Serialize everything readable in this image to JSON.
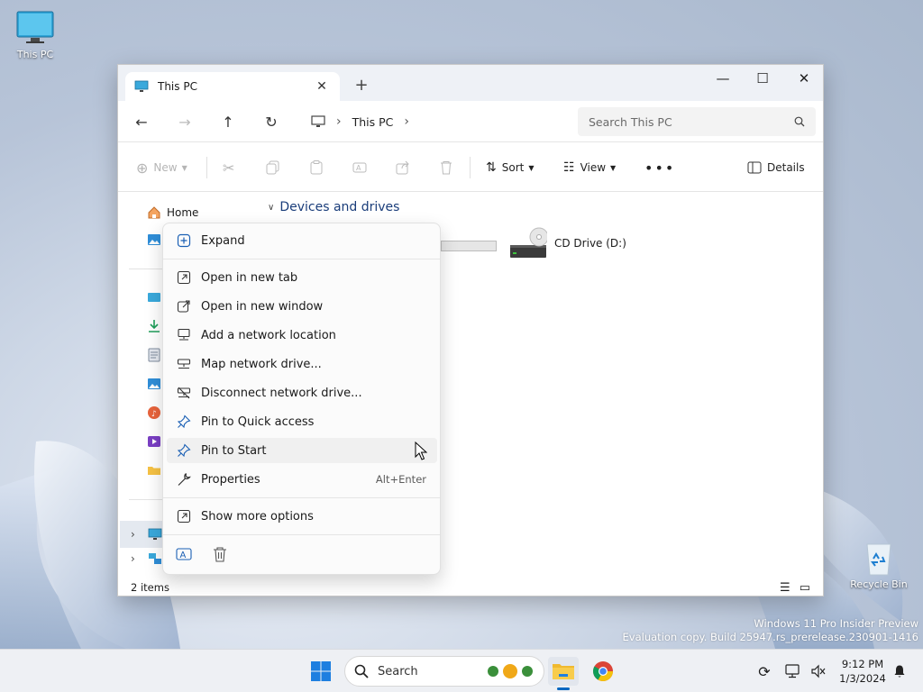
{
  "desktop": {
    "icons": [
      {
        "label": "This PC"
      },
      {
        "label": "Recycle Bin"
      }
    ]
  },
  "window": {
    "tab_title": "This PC",
    "address": {
      "segments": [
        "This PC"
      ]
    },
    "search_placeholder": "Search This PC",
    "commands": {
      "new": "New",
      "sort": "Sort",
      "view": "View",
      "details": "Details"
    },
    "sidebar": {
      "home": "Home"
    },
    "group_title": "Devices and drives",
    "drives": [
      {
        "label": "CD Drive (D:)"
      }
    ],
    "status": "2 items"
  },
  "context_menu": {
    "items": [
      {
        "label": "Expand",
        "icon": "expand-icon"
      },
      {
        "label": "Open in new tab",
        "icon": "new-tab-icon"
      },
      {
        "label": "Open in new window",
        "icon": "new-window-icon"
      },
      {
        "label": "Add a network location",
        "icon": "network-location-icon"
      },
      {
        "label": "Map network drive...",
        "icon": "map-drive-icon"
      },
      {
        "label": "Disconnect network drive...",
        "icon": "disconnect-drive-icon"
      },
      {
        "label": "Pin to Quick access",
        "icon": "pin-icon"
      },
      {
        "label": "Pin to Start",
        "icon": "pin-start-icon"
      },
      {
        "label": "Properties",
        "icon": "wrench-icon",
        "shortcut": "Alt+Enter"
      },
      {
        "label": "Show more options",
        "icon": "more-options-icon"
      }
    ]
  },
  "taskbar": {
    "search_label": "Search",
    "time": "9:12 PM",
    "date": "1/3/2024"
  },
  "watermark": {
    "line1": "Windows 11 Pro Insider Preview",
    "line2": "Evaluation copy. Build 25947.rs_prerelease.230901-1416"
  },
  "colors": {
    "accent": "#0067c0",
    "folder": "#f6c244",
    "group_title": "#1a3d7a"
  }
}
